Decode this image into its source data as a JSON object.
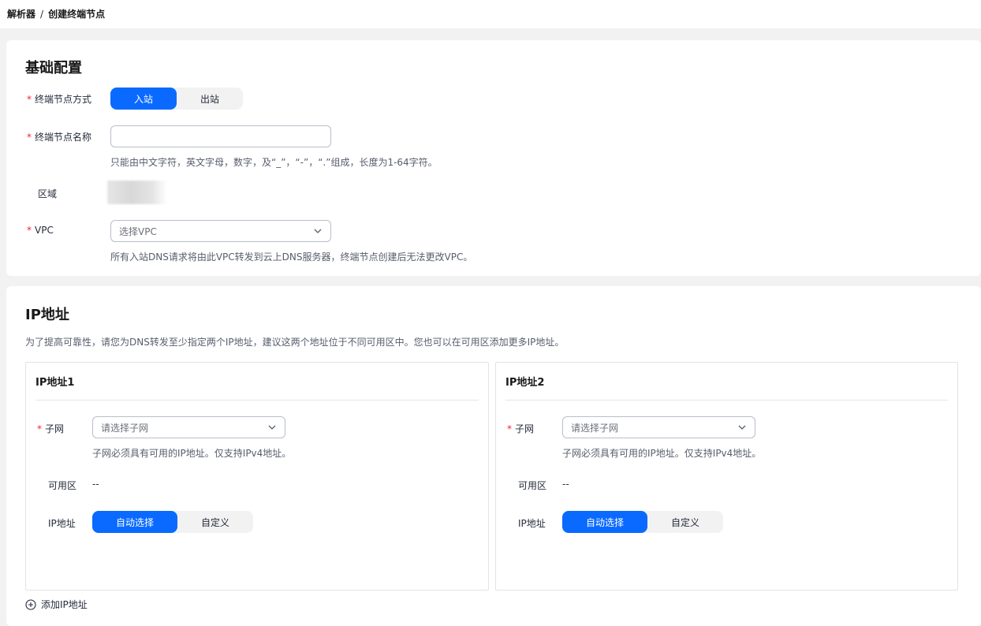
{
  "breadcrumb": {
    "items": [
      "解析器",
      "创建终端节点"
    ],
    "separator": "/"
  },
  "basic": {
    "title": "基础配置",
    "mode": {
      "label": "终端节点方式",
      "options": [
        "入站",
        "出站"
      ],
      "selected": "入站"
    },
    "name": {
      "label": "终端节点名称",
      "value": "",
      "placeholder": "",
      "hint": "只能由中文字符，英文字母，数字，及“_”，“-”，“.”组成，长度为1-64字符。"
    },
    "region": {
      "label": "区域"
    },
    "vpc": {
      "label": "VPC",
      "placeholder": "选择VPC",
      "hint": "所有入站DNS请求将由此VPC转发到云上DNS服务器，终端节点创建后无法更改VPC。"
    }
  },
  "ip": {
    "title": "IP地址",
    "description": "为了提高可靠性，请您为DNS转发至少指定两个IP地址，建议这两个地址位于不同可用区中。您也可以在可用区添加更多IP地址。",
    "cards": [
      {
        "title": "IP地址1",
        "subnet_label": "子网",
        "subnet_placeholder": "请选择子网",
        "subnet_hint": "子网必须具有可用的IP地址。仅支持IPv4地址。",
        "az_label": "可用区",
        "az_value": "--",
        "ip_label": "IP地址",
        "ip_options": [
          "自动选择",
          "自定义"
        ],
        "ip_selected": "自动选择"
      },
      {
        "title": "IP地址2",
        "subnet_label": "子网",
        "subnet_placeholder": "请选择子网",
        "subnet_hint": "子网必须具有可用的IP地址。仅支持IPv4地址。",
        "az_label": "可用区",
        "az_value": "--",
        "ip_label": "IP地址",
        "ip_options": [
          "自动选择",
          "自定义"
        ],
        "ip_selected": "自动选择"
      }
    ],
    "add_label": "添加IP地址"
  },
  "colors": {
    "primary": "#0a6aff",
    "required": "#f5222d",
    "page_bg": "#f2f2f2"
  }
}
